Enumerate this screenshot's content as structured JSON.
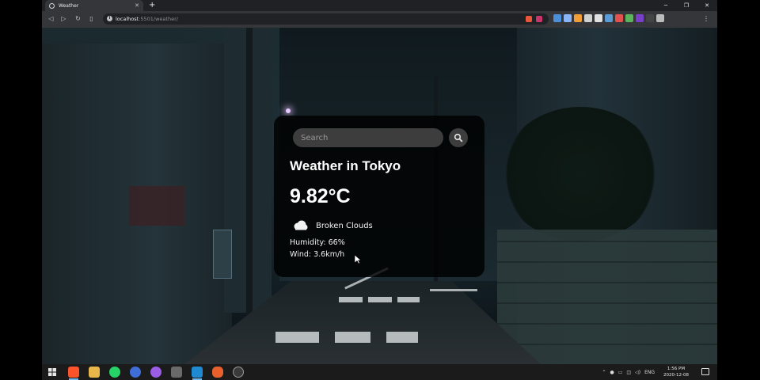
{
  "browser": {
    "tab_title": "Weather",
    "tab_close": "✕",
    "new_tab": "+",
    "url_host": "localhost",
    "url_rest": ":5501/weather/",
    "menu_icon": "⋮",
    "nav_back": "◁",
    "nav_forward": "▷",
    "nav_reload": "↻",
    "nav_bookmark": "▯",
    "window_minimize": "─",
    "window_restore": "❐",
    "window_close": "✕"
  },
  "weather": {
    "search_placeholder": "Search",
    "city_title": "Weather in Tokyo",
    "temperature": "9.82°C",
    "description": "Broken Clouds",
    "humidity": "Humidity: 66%",
    "wind": "Wind: 3.6km/h"
  },
  "taskbar": {
    "time": "1:56 PM",
    "date": "2020-12-08",
    "lang": "ENG"
  }
}
